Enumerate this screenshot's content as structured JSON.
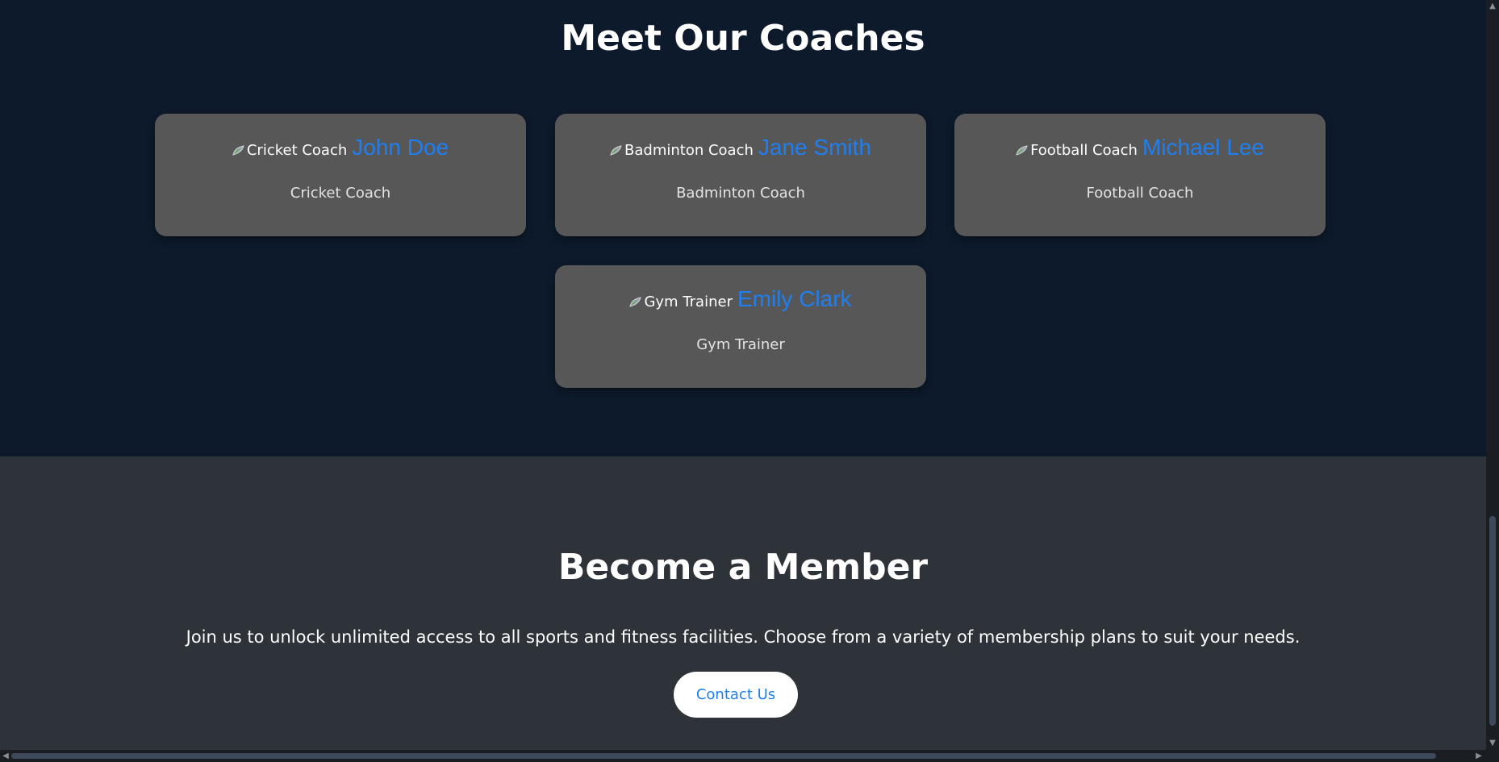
{
  "coaches": {
    "title": "Meet Our Coaches",
    "cards": [
      {
        "image_alt": "Cricket Coach",
        "name": "John Doe",
        "role": "Cricket Coach"
      },
      {
        "image_alt": "Badminton Coach",
        "name": "Jane Smith",
        "role": "Badminton Coach"
      },
      {
        "image_alt": "Football Coach",
        "name": "Michael Lee",
        "role": "Football Coach"
      },
      {
        "image_alt": "Gym Trainer",
        "name": "Emily Clark",
        "role": "Gym Trainer"
      }
    ]
  },
  "membership": {
    "title": "Become a Member",
    "description": "Join us to unlock unlimited access to all sports and fitness facilities. Choose from a variety of membership plans to suit your needs.",
    "button_label": "Contact Us"
  },
  "colors": {
    "page_background": "#0d1a2b",
    "card_background": "#575757",
    "member_background": "#2d3339",
    "accent": "#1f7ff0"
  },
  "icons": {
    "broken_image": "broken-image-icon",
    "scroll_up": "chevron-up-icon",
    "scroll_down": "chevron-down-icon",
    "scroll_left": "chevron-left-icon",
    "scroll_right": "chevron-right-icon"
  }
}
